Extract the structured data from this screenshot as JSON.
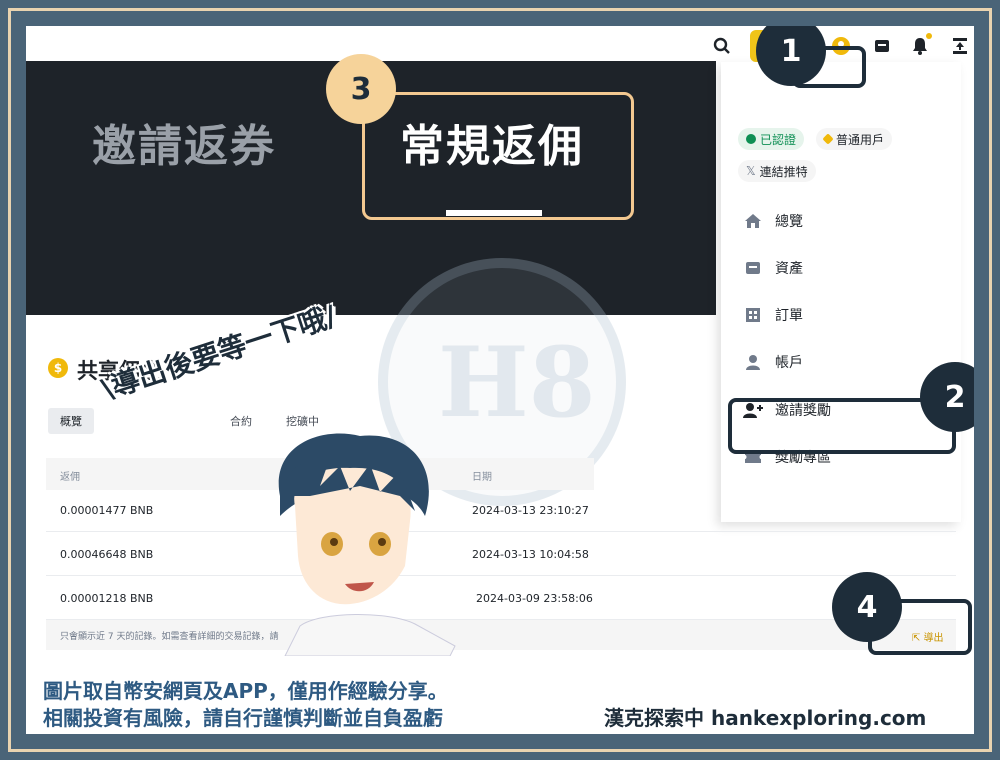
{
  "banner": {
    "tab_invite": "邀請返券",
    "tab_regular": "常規返佣"
  },
  "steps": [
    "1",
    "2",
    "3",
    "4"
  ],
  "menu": {
    "badges": {
      "verified": "已認證",
      "account_type": "普通用戶",
      "link_x": "連結推特"
    },
    "items": [
      {
        "label": "總覽",
        "icon": "home-icon"
      },
      {
        "label": "資產",
        "icon": "wallet-icon"
      },
      {
        "label": "訂單",
        "icon": "orders-icon"
      },
      {
        "label": "帳戶",
        "icon": "person-icon"
      },
      {
        "label": "邀請獎勵",
        "icon": "add-user-icon"
      },
      {
        "label": "獎勵專區",
        "icon": "ticket-icon"
      }
    ]
  },
  "commission": {
    "title": "共享佣金",
    "tabs": [
      "概覽",
      "合約",
      "挖礦中"
    ],
    "columns": {
      "amount": "返佣",
      "date": "日期"
    },
    "rows": [
      {
        "amount": "0.00001477 BNB",
        "date": "2024-03-13 23:10:27"
      },
      {
        "amount": "0.00046648 BNB",
        "date": "2024-03-13 10:04:58"
      },
      {
        "amount": "0.00001218 BNB",
        "date": "2024-03-09 23:58:06"
      }
    ],
    "note": "只會顯示近 7 天的記錄。如需查看詳細的交易記錄，請",
    "export_label": "導出"
  },
  "overlay": {
    "sticker": "\\導出後要等一下哦/",
    "watermark": "H8"
  },
  "footer": {
    "disclaimer_line1": "圖片取自幣安網頁及APP，僅用作經驗分享。",
    "disclaimer_line2": "相關投資有風險，請自行謹慎判斷並自負盈虧",
    "brand": "漢克探索中 hankexploring.com"
  },
  "colors": {
    "accent": "#f0b90b",
    "frame": "#4a6478",
    "highlight": "#f6d39a",
    "step_dark": "#1e2d3a",
    "footer_text": "#2e5a82"
  }
}
